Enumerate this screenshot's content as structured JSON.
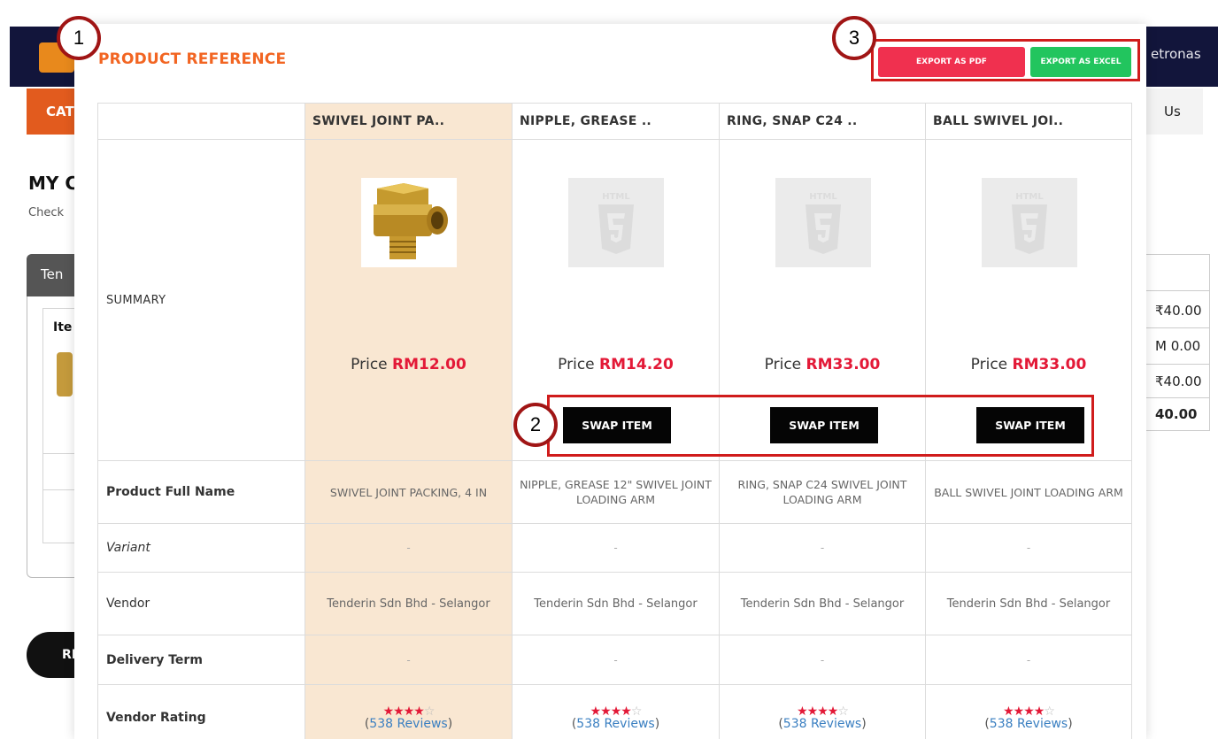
{
  "background": {
    "brand_fragment": "etronas",
    "cat_tab": "CAT",
    "right_tab": "Us",
    "page_title": "MY C",
    "page_sub": "Check",
    "panel_tab": "Ten",
    "inner_label": "Ite",
    "rfq_button": "RF",
    "amounts": [
      "₹40.00",
      "M 0.00",
      "₹40.00",
      "40.00"
    ]
  },
  "modal": {
    "title": "PRODUCT REFERENCE",
    "export_pdf_label": "EXPORT AS PDF",
    "export_excel_label": "EXPORT AS EXCEL",
    "columns": [
      "SWIVEL JOINT PA..",
      "NIPPLE, GREASE ..",
      "RING, SNAP C24 ..",
      "BALL SWIVEL JOI.."
    ],
    "row_labels": {
      "summary": "SUMMARY",
      "full_name": "Product Full Name",
      "variant": "Variant",
      "vendor": "Vendor",
      "delivery": "Delivery Term",
      "rating": "Vendor Rating"
    },
    "price_prefix": "Price",
    "prices": [
      "RM12.00",
      "RM14.20",
      "RM33.00",
      "RM33.00"
    ],
    "swap_label": "SWAP ITEM",
    "full_names": [
      "SWIVEL JOINT PACKING, 4 IN",
      "NIPPLE, GREASE 12\" SWIVEL JOINT LOADING ARM",
      "RING, SNAP C24 SWIVEL JOINT LOADING ARM",
      "BALL SWIVEL JOINT LOADING ARM"
    ],
    "variant_value": "-",
    "vendor_value": "Tenderin Sdn Bhd - Selangor",
    "delivery_value": "-",
    "stars_filled": "★★★★",
    "stars_empty": "☆",
    "rating": 4,
    "reviews_count": "538 Reviews",
    "placeholder_icon": "html5-icon"
  },
  "annotations": [
    "1",
    "2",
    "3"
  ],
  "colors": {
    "title": "#f26522",
    "price": "#e31937",
    "pdf": "#f0304f",
    "excel": "#22c55e",
    "highlight_column": "#f9e7d2",
    "annotation_border": "#d01c1c"
  }
}
